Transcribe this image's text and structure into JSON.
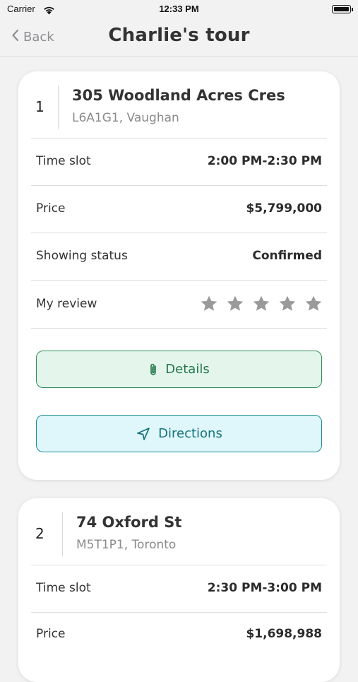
{
  "status_bar": {
    "carrier": "Carrier",
    "time": "12:33 PM"
  },
  "nav": {
    "back_label": "Back",
    "title": "Charlie's tour"
  },
  "colors": {
    "details_accent": "#2f8b5a",
    "directions_accent": "#1d8b96",
    "star_empty": "#9a9a9a"
  },
  "stops": [
    {
      "number": "1",
      "address": "305 Woodland Acres Cres",
      "postal_city": "L6A1G1, Vaughan",
      "time_slot_label": "Time slot",
      "time_slot": "2:00 PM-2:30 PM",
      "price_label": "Price",
      "price": "$5,799,000",
      "status_label": "Showing status",
      "status": "Confirmed",
      "review_label": "My review",
      "review_rating": 0,
      "review_max": 5,
      "details_label": "Details",
      "directions_label": "Directions"
    },
    {
      "number": "2",
      "address": "74 Oxford St",
      "postal_city": "M5T1P1, Toronto",
      "time_slot_label": "Time slot",
      "time_slot": "2:30 PM-3:00 PM",
      "price_label": "Price",
      "price": "$1,698,988"
    }
  ]
}
